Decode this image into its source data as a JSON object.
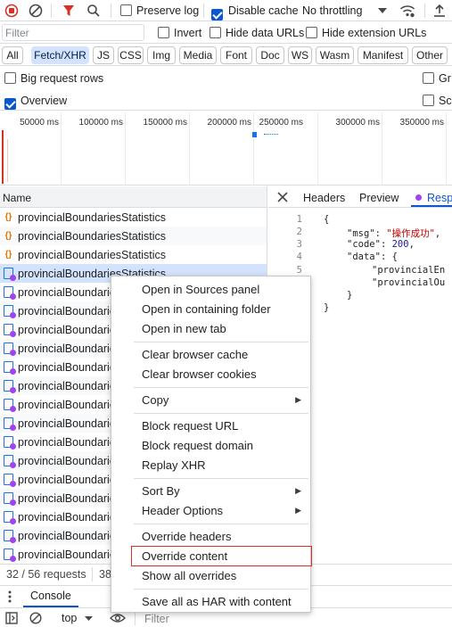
{
  "toolbar": {
    "preserve_log": "Preserve log",
    "disable_cache": "Disable cache",
    "throttling": "No throttling"
  },
  "filter": {
    "placeholder": "Filter",
    "invert": "Invert",
    "hide_data_urls": "Hide data URLs",
    "hide_extension_urls": "Hide extension URLs"
  },
  "types": [
    "All",
    "Fetch/XHR",
    "JS",
    "CSS",
    "Img",
    "Media",
    "Font",
    "Doc",
    "WS",
    "Wasm",
    "Manifest",
    "Other"
  ],
  "options": {
    "big_request_rows": "Big request rows",
    "overview": "Overview",
    "group_cut": "Gr",
    "screenshots_cut": "Sc"
  },
  "timeline_ticks": [
    "50000 ms",
    "100000 ms",
    "150000 ms",
    "200000 ms",
    "250000 ms",
    "300000 ms",
    "350000 ms"
  ],
  "list": {
    "name_header": "Name",
    "rows": [
      {
        "name": "provincialBoundariesStatistics",
        "type": "fetch"
      },
      {
        "name": "provincialBoundariesStatistics",
        "type": "fetch"
      },
      {
        "name": "provincialBoundariesStatistics",
        "type": "fetch"
      },
      {
        "name": "provincialBoundariesStatistics",
        "type": "xhr"
      },
      {
        "name": "provincialBoundaries",
        "type": "xhr"
      },
      {
        "name": "provincialBoundaries",
        "type": "xhr"
      },
      {
        "name": "provincialBoundaries",
        "type": "xhr"
      },
      {
        "name": "provincialBoundaries",
        "type": "xhr"
      },
      {
        "name": "provincialBoundaries",
        "type": "xhr"
      },
      {
        "name": "provincialBoundaries",
        "type": "xhr"
      },
      {
        "name": "provincialBoundaries",
        "type": "xhr"
      },
      {
        "name": "provincialBoundaries",
        "type": "xhr"
      },
      {
        "name": "provincialBoundaries",
        "type": "xhr"
      },
      {
        "name": "provincialBoundaries",
        "type": "xhr"
      },
      {
        "name": "provincialBoundaries",
        "type": "xhr"
      },
      {
        "name": "provincialBoundaries",
        "type": "xhr"
      },
      {
        "name": "provincialBoundaries",
        "type": "xhr"
      },
      {
        "name": "provincialBoundaries",
        "type": "xhr"
      },
      {
        "name": "provincialBoundaries",
        "type": "xhr"
      }
    ]
  },
  "details": {
    "tabs": [
      "Headers",
      "Preview",
      "Resp"
    ],
    "code": [
      {
        "n": "1",
        "text": "{"
      },
      {
        "n": "2",
        "key": "\"msg\"",
        "val": "\"操作成功\"",
        "tail": ","
      },
      {
        "n": "3",
        "key": "\"code\"",
        "num": "200",
        "tail": ","
      },
      {
        "n": "4",
        "key": "\"data\"",
        "tail": ": {"
      },
      {
        "n": "5",
        "key": "\"provincialEn",
        "tail": ""
      },
      {
        "n": "",
        "key": "\"provincialOu",
        "tail": ""
      },
      {
        "n": "",
        "text": "}"
      },
      {
        "n": "",
        "text": "}"
      }
    ]
  },
  "status": {
    "requests": "32 / 56 requests",
    "transferred_cut": "38"
  },
  "drawer": {
    "console_tab": "Console",
    "context": "top",
    "filter_placeholder": "Filter"
  },
  "context_menu": {
    "items": [
      "Open in Sources panel",
      "Open in containing folder",
      "Open in new tab",
      "Clear browser cache",
      "Clear browser cookies",
      "Copy",
      "Block request URL",
      "Block request domain",
      "Replay XHR",
      "Sort By",
      "Header Options",
      "Override headers",
      "Override content",
      "Show all overrides",
      "Save all as HAR with content"
    ]
  }
}
